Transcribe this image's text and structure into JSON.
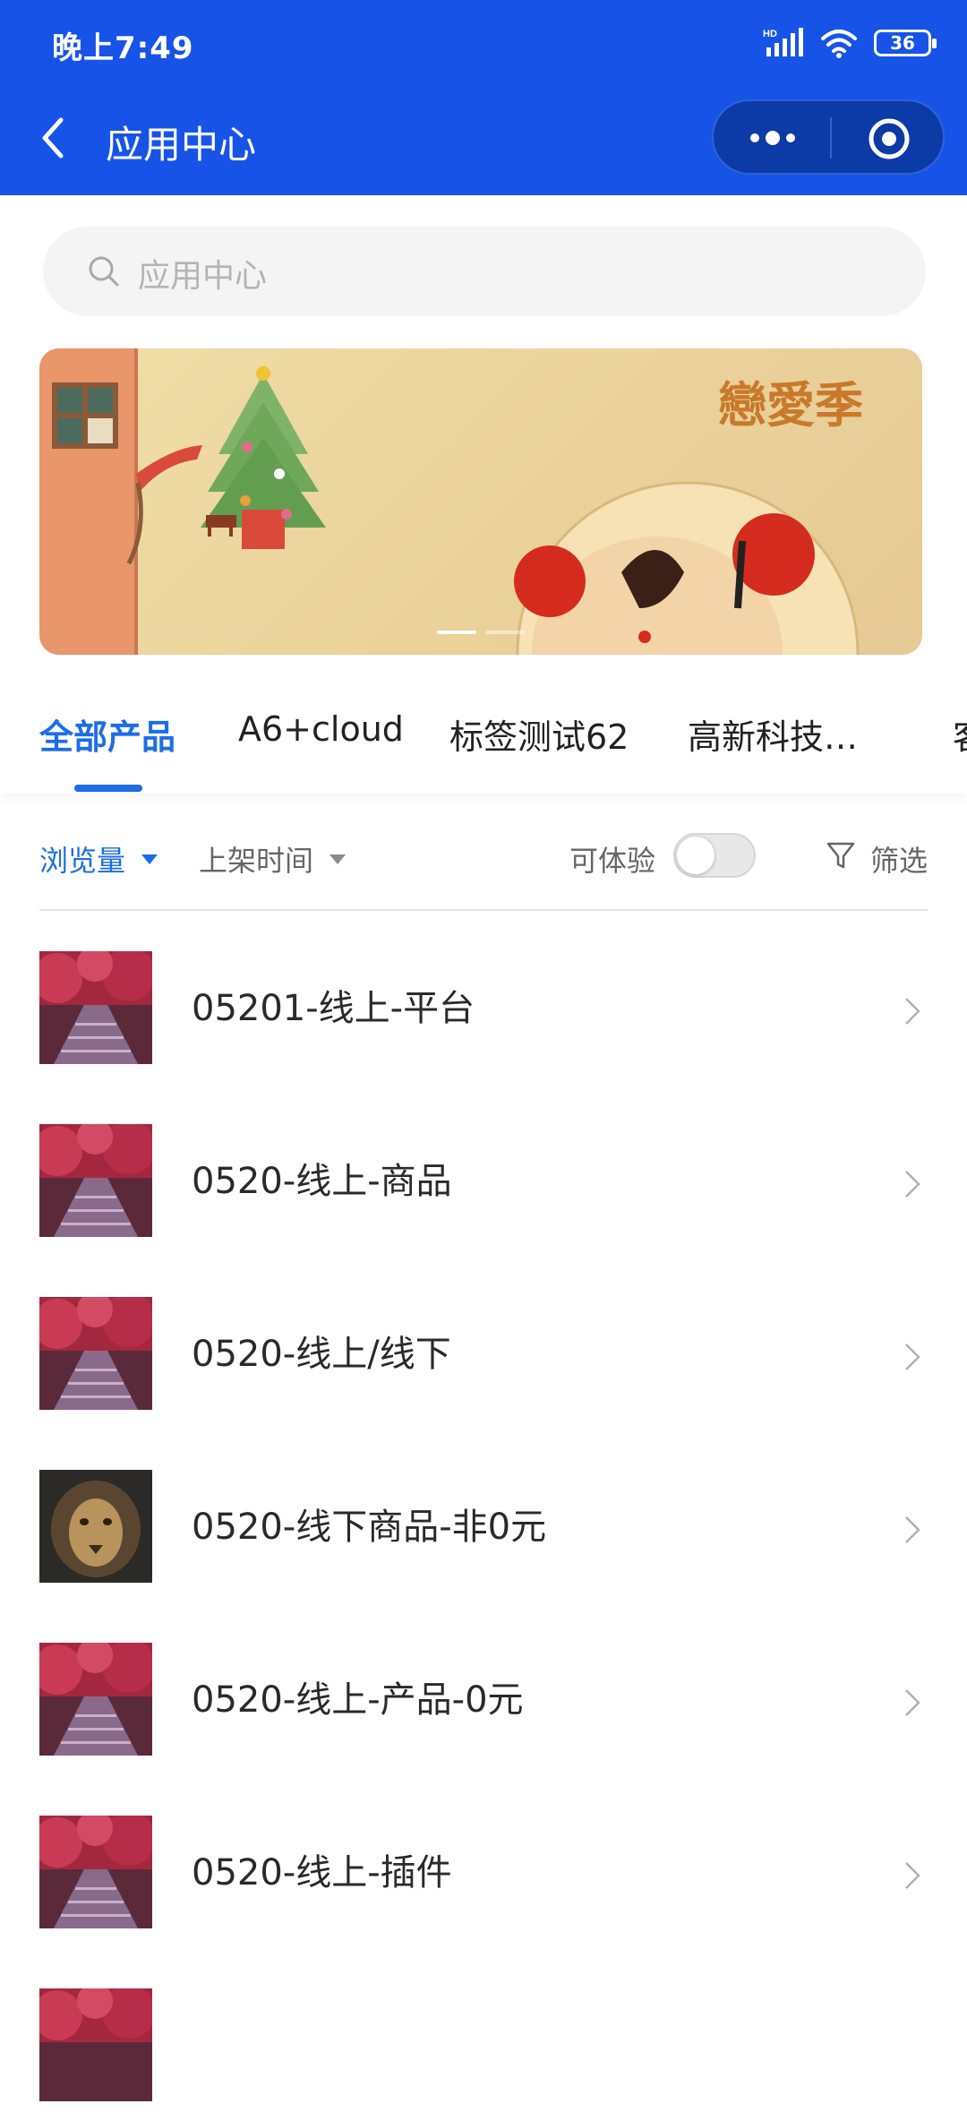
{
  "status_bar": {
    "time": "晚上7:49",
    "network_label": "HD",
    "battery": "36"
  },
  "header": {
    "title": "应用中心",
    "back_icon": "chevron-left-icon",
    "more_icon": "more-dots-icon",
    "close_icon": "target-circle-icon",
    "background_color": "#1853e8"
  },
  "search": {
    "placeholder": "应用中心"
  },
  "banner": {
    "text": "戀愛季",
    "slides": 2,
    "active_slide": 1
  },
  "tabs": [
    {
      "label": "全部产品",
      "active": true
    },
    {
      "label": "A6+cloud",
      "active": false
    },
    {
      "label": "标签测试62",
      "active": false
    },
    {
      "label": "高新科技…",
      "active": false
    },
    {
      "label": "客",
      "active": false
    }
  ],
  "filters": {
    "sort_views": "浏览量",
    "sort_time": "上架时间",
    "trial_label": "可体验",
    "trial_enabled": false,
    "filter_label": "筛选",
    "accent_color": "#1c6de8"
  },
  "products": [
    {
      "title": "05201-线上-平台",
      "thumb": "autumn-path"
    },
    {
      "title": "0520-线上-商品",
      "thumb": "autumn-path"
    },
    {
      "title": "0520-线上/线下",
      "thumb": "autumn-path"
    },
    {
      "title": "0520-线下商品-非0元",
      "thumb": "lion"
    },
    {
      "title": "0520-线上-产品-0元",
      "thumb": "autumn-path"
    },
    {
      "title": "0520-线上-插件",
      "thumb": "autumn-path"
    },
    {
      "title": "",
      "thumb": "autumn-path"
    }
  ]
}
